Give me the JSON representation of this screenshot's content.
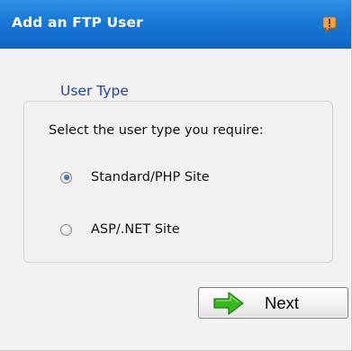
{
  "dialog": {
    "title": "Add an FTP User",
    "help_icon": "info-exclamation-icon"
  },
  "user_type": {
    "legend": "User Type",
    "prompt": "Select the user type you require:",
    "options": [
      {
        "label": "Standard/PHP Site",
        "selected": true
      },
      {
        "label": "ASP/.NET Site",
        "selected": false
      }
    ]
  },
  "actions": {
    "next_label": "Next",
    "next_icon": "green-right-arrow-icon"
  },
  "colors": {
    "title_bar": "#1a78d6",
    "legend_text": "#1f3fbf",
    "arrow_green": "#37b81e"
  }
}
